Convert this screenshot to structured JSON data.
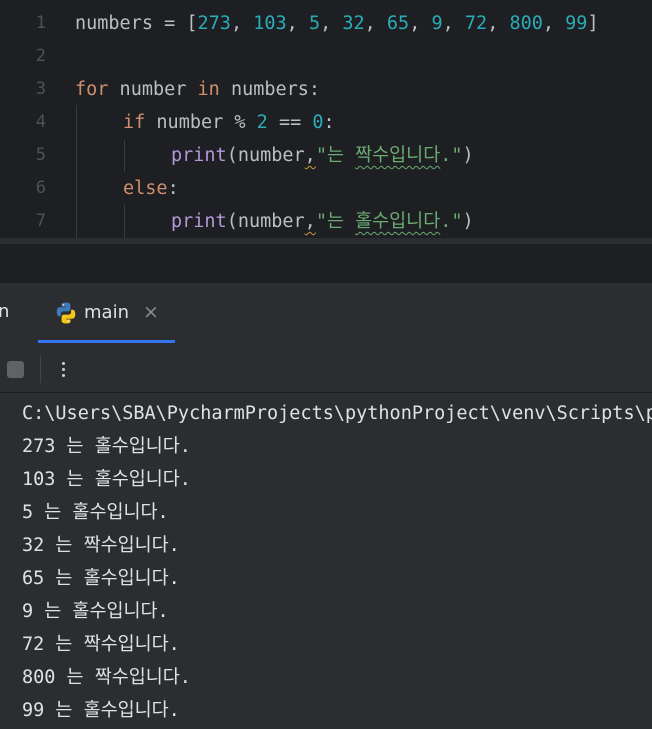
{
  "editor": {
    "line_numbers": [
      "1",
      "2",
      "3",
      "4",
      "5",
      "6",
      "7"
    ],
    "line1": {
      "var": "numbers",
      "op": " = ",
      "open": "[",
      "items": [
        "273",
        "103",
        "5",
        "32",
        "65",
        "9",
        "72",
        "800",
        "99"
      ],
      "sep": ", ",
      "close": "]"
    },
    "line3": {
      "kw_for": "for",
      "var": " number ",
      "kw_in": "in",
      "rest": " numbers:"
    },
    "line4": {
      "kw_if": "if",
      "mid": " number % ",
      "n2": "2",
      "eq": " == ",
      "n0": "0",
      "colon": ":"
    },
    "line5": {
      "fn": "print",
      "args": "(number",
      "comma": ",",
      "str_open": "\"는 ",
      "str_word": "짝수입니다",
      "str_close": ".\"",
      "paren": ")"
    },
    "line6": {
      "kw_else": "else",
      "colon": ":"
    },
    "line7": {
      "fn": "print",
      "args": "(number",
      "comma": ",",
      "str_open": "\"는 ",
      "str_word": "홀수입니다",
      "str_close": ".\"",
      "paren": ")"
    }
  },
  "run_panel": {
    "left_tab_fragment": "n",
    "tab_label": "main",
    "close_glyph": "×",
    "icons": {
      "tab": "python-icon",
      "close": "close-icon",
      "stop": "stop-icon",
      "more": "more-vertical-icon"
    }
  },
  "console": {
    "lines": [
      "C:\\Users\\SBA\\PycharmProjects\\pythonProject\\venv\\Scripts\\python.exe",
      "273 는 홀수입니다.",
      "103 는 홀수입니다.",
      "5 는 홀수입니다.",
      "32 는 짝수입니다.",
      "65 는 홀수입니다.",
      "9 는 홀수입니다.",
      "72 는 짝수입니다.",
      "800 는 짝수입니다.",
      "99 는 홀수입니다."
    ]
  },
  "colors": {
    "background": "#1e1f22",
    "panel": "#2b2d30",
    "keyword": "#cf8e6d",
    "number": "#2aacb8",
    "string": "#6aab73",
    "function": "#b298d8",
    "accent": "#3574f0"
  }
}
